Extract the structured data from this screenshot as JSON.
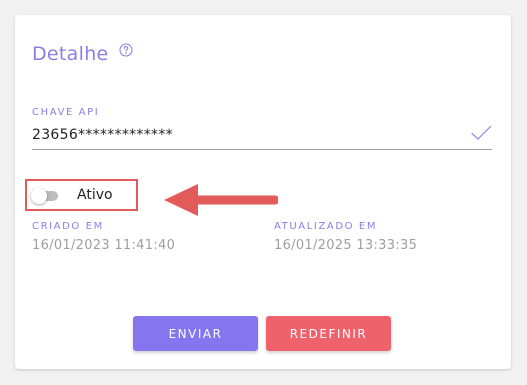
{
  "card": {
    "title": "Detalhe",
    "help_icon": "help-circle-icon"
  },
  "api_key": {
    "label": "CHAVE API",
    "value": "23656*************",
    "status_icon": "check-icon"
  },
  "active_toggle": {
    "label": "Ativo",
    "checked": false
  },
  "created": {
    "label": "CRIADO EM",
    "value": "16/01/2023 11:41:40"
  },
  "updated": {
    "label": "ATUALIZADO EM",
    "value": "16/01/2025 13:33:35"
  },
  "actions": {
    "send_label": "ENVIAR",
    "reset_label": "REDEFINIR"
  },
  "colors": {
    "accent": "#8b7ee6",
    "primary_button": "#8575ee",
    "danger_button": "#f0626b",
    "annotation": "#e35a5a"
  }
}
